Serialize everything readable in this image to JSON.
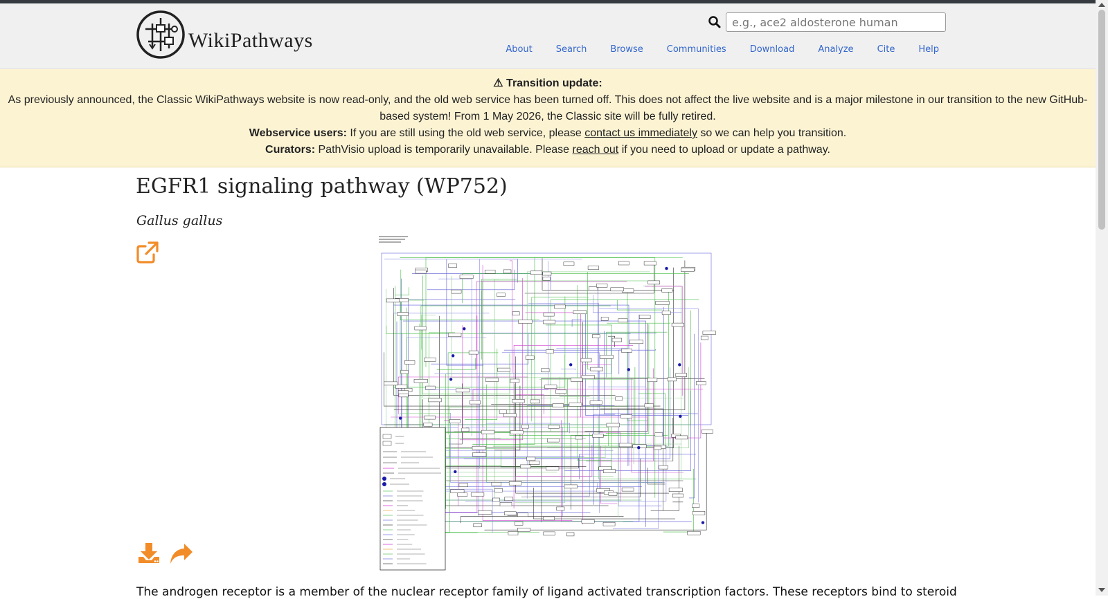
{
  "header": {
    "logo_text": "WikiPathways",
    "search_placeholder": "e.g., ace2 aldosterone human",
    "nav": [
      {
        "label": "About"
      },
      {
        "label": "Search"
      },
      {
        "label": "Browse"
      },
      {
        "label": "Communities"
      },
      {
        "label": "Download"
      },
      {
        "label": "Analyze"
      },
      {
        "label": "Cite"
      },
      {
        "label": "Help"
      }
    ]
  },
  "banner": {
    "title": "⚠ Transition update:",
    "text": "As previously announced, the Classic WikiPathways website is now read-only, and the old web service has been turned off. This does not affect the live website and is a major milestone in our transition to the new GitHub-based system! From 1 May 2026, the Classic site will be fully retired.",
    "webservice_label": "Webservice users:",
    "webservice_pre": " If you are still using the old web service, please ",
    "webservice_link": "contact us immediately",
    "webservice_post": " so we can help you transition.",
    "curators_label": "Curators:",
    "curators_pre": " PathVisio upload is temporarily unavailable. Please ",
    "curators_link": "reach out",
    "curators_post": " if you need to upload or update a pathway."
  },
  "pathway": {
    "title": "EGFR1 signaling pathway (WP752)",
    "species": "Gallus gallus",
    "description": "The androgen receptor is a member of the nuclear receptor family of ligand activated transcription factors. These receptors bind to steroid"
  },
  "colors": {
    "accent_orange": "#f28c28",
    "link_blue": "#3366cc",
    "banner_bg": "#fcf3d3"
  },
  "icons": {
    "search": "search-icon",
    "external": "external-link-icon",
    "download": "download-icon",
    "share": "share-icon"
  }
}
